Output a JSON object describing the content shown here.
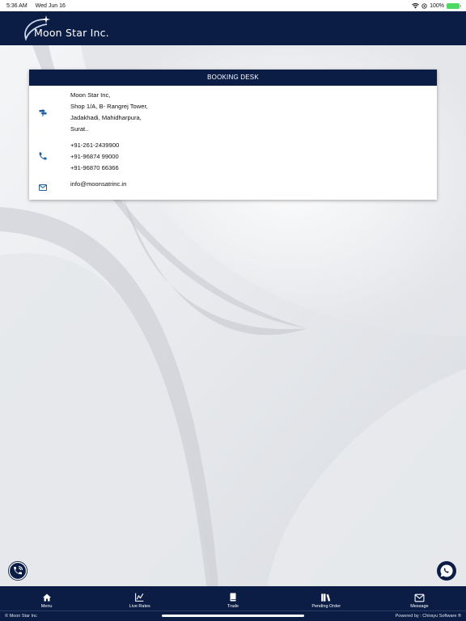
{
  "status_bar": {
    "time": "5:36 AM",
    "date": "Wed Jun 16",
    "battery": "100%",
    "icons": [
      "wifi-icon",
      "location-icon",
      "battery-icon"
    ]
  },
  "header": {
    "logo_text": "Moon Star Inc.",
    "brand_color": "#0b1d45"
  },
  "booking_desk": {
    "title": "BOOKING DESK",
    "address_lines": [
      "Moon Star Inc,",
      "Shop 1/A, B- Rangrej Tower,",
      "Jadakhadi, Mahidharpura,",
      "Surat.."
    ],
    "phones": [
      "+91-261-2439900",
      "+91-96874 99000",
      "+91-96870 66366"
    ],
    "email": "info@moonsatrinc.in",
    "icons": {
      "address": "signpost-icon",
      "phone": "phone-icon",
      "email": "mail-icon"
    },
    "icon_color": "#1f5f9a"
  },
  "floating": {
    "call": "phone-ring-icon",
    "whatsapp": "whatsapp-icon"
  },
  "bottom_nav": {
    "items": [
      {
        "label": "Menu",
        "icon": "home-icon"
      },
      {
        "label": "Live Rates",
        "icon": "chart-icon"
      },
      {
        "label": "Trade",
        "icon": "book-icon"
      },
      {
        "label": "Pending Order",
        "icon": "books-icon"
      },
      {
        "label": "Message",
        "icon": "envelope-icon"
      }
    ]
  },
  "footer": {
    "left": "© Moon Star Inc",
    "right": "Powered by : Chirayu Software ®"
  }
}
